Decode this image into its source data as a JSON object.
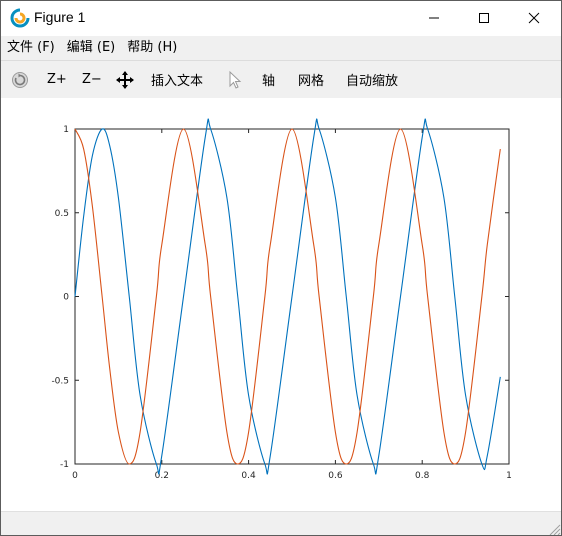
{
  "window": {
    "title": "Figure 1",
    "controls": [
      "minimize",
      "maximize",
      "close"
    ]
  },
  "menubar": {
    "items": [
      {
        "label": "文件 (F)"
      },
      {
        "label": "编辑 (E)"
      },
      {
        "label": "帮助 (H)"
      }
    ]
  },
  "toolbar": {
    "rotate_icon": "rotate-icon",
    "zoom_in_label": "Z+",
    "zoom_out_label": "Z−",
    "pan_icon": "pan-arrows-icon",
    "insert_text_label": "插入文本",
    "select_icon": "cursor-arrow-icon",
    "axis_label": "轴",
    "grid_label": "网格",
    "autoscale_label": "自动缩放"
  },
  "colors": {
    "series_blue": "#0072bd",
    "series_orange": "#d95319",
    "menu_bg": "#f0f0f0"
  },
  "chart_data": {
    "type": "line",
    "title": "",
    "xlabel": "",
    "ylabel": "",
    "xlim": [
      0,
      1
    ],
    "ylim": [
      -1,
      1
    ],
    "grid": false,
    "legend": "none",
    "x_ticks": [
      "0",
      "0.2",
      "0.4",
      "0.6",
      "0.8",
      "1"
    ],
    "y_ticks": [
      "-1",
      "-0.5",
      "0",
      "0.5",
      "1"
    ],
    "series": [
      {
        "color": "#0072bd",
        "x": [
          0.0,
          0.02,
          0.04,
          0.0625,
          0.08,
          0.1,
          0.125,
          0.15,
          0.1875,
          0.2,
          0.25,
          0.3,
          0.3125,
          0.35,
          0.375,
          0.4,
          0.4375,
          0.45,
          0.5,
          0.55,
          0.5625,
          0.6,
          0.625,
          0.65,
          0.6875,
          0.7,
          0.75,
          0.8,
          0.8125,
          0.85,
          0.875,
          0.9,
          0.9375,
          0.95,
          0.98
        ],
        "y": [
          0.0,
          0.48,
          0.84,
          1.0,
          0.9,
          0.59,
          0.0,
          -0.59,
          -1.0,
          -0.95,
          0.0,
          0.95,
          1.0,
          0.59,
          0.0,
          -0.59,
          -1.0,
          -0.95,
          0.0,
          0.95,
          1.0,
          0.59,
          0.0,
          -0.59,
          -1.0,
          -0.95,
          0.0,
          0.95,
          1.0,
          0.59,
          0.0,
          -0.59,
          -1.0,
          -0.95,
          -0.48
        ]
      },
      {
        "color": "#d95319",
        "x": [
          0.0,
          0.02,
          0.04,
          0.0625,
          0.08,
          0.1,
          0.125,
          0.15,
          0.1875,
          0.2,
          0.25,
          0.3,
          0.3125,
          0.35,
          0.375,
          0.4,
          0.4375,
          0.45,
          0.5,
          0.55,
          0.5625,
          0.6,
          0.625,
          0.65,
          0.6875,
          0.7,
          0.75,
          0.8,
          0.8125,
          0.85,
          0.875,
          0.9,
          0.9375,
          0.95,
          0.98
        ],
        "y": [
          1.0,
          0.88,
          0.54,
          0.0,
          -0.43,
          -0.81,
          -1.0,
          -0.81,
          0.0,
          0.31,
          1.0,
          0.31,
          0.0,
          -0.81,
          -1.0,
          -0.81,
          0.0,
          0.31,
          1.0,
          0.31,
          0.0,
          -0.81,
          -1.0,
          -0.81,
          0.0,
          0.31,
          1.0,
          0.31,
          0.0,
          -0.81,
          -1.0,
          -0.81,
          0.0,
          0.31,
          0.88
        ]
      }
    ]
  }
}
